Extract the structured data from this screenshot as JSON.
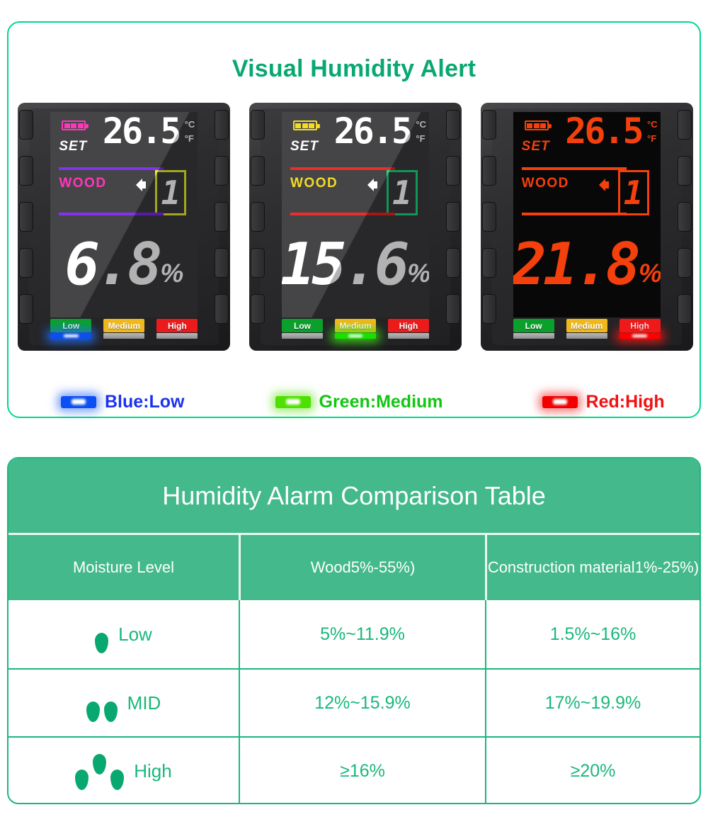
{
  "alert": {
    "title": "Visual Humidity Alert",
    "devices": [
      {
        "theme": "grey",
        "battery_color": "#ff2bb5",
        "set_label": "SET",
        "set_color": "#ffffff",
        "temperature": "26.5",
        "temp_color": "#ffffff",
        "unit_c": "°C",
        "unit_f": "°F",
        "rule_color": "#7b27ef",
        "mode_label": "WOOD",
        "mode_color": "#ff2bb5",
        "speaker_color": "#ffffff",
        "level_box_color": "#e8ef2a",
        "level_value": "1",
        "level_value_color": "#ffffff",
        "humidity": "6.8",
        "humidity_unit": "%",
        "humidity_color": "#ffffff",
        "leds": [
          {
            "label": "Low",
            "bg": "#0ba02c",
            "state": "on-blue"
          },
          {
            "label": "Medium",
            "bg": "#f0b81c",
            "state": "off"
          },
          {
            "label": "High",
            "bg": "#ec1b1b",
            "state": "off"
          }
        ]
      },
      {
        "theme": "grey",
        "battery_color": "#f2d91c",
        "set_label": "SET",
        "set_color": "#ffffff",
        "temperature": "26.5",
        "temp_color": "#ffffff",
        "unit_c": "°C",
        "unit_f": "°F",
        "rule_color": "#e8231f",
        "mode_label": "WOOD",
        "mode_color": "#f2d91c",
        "speaker_color": "#ffffff",
        "level_box_color": "#18d67e",
        "level_value": "1",
        "level_value_color": "#ffffff",
        "humidity": "15.6",
        "humidity_unit": "%",
        "humidity_color": "#ffffff",
        "leds": [
          {
            "label": "Low",
            "bg": "#0ba02c",
            "state": "off"
          },
          {
            "label": "Medium",
            "bg": "#f0b81c",
            "state": "on-green"
          },
          {
            "label": "High",
            "bg": "#ec1b1b",
            "state": "off"
          }
        ]
      },
      {
        "theme": "black",
        "battery_color": "#f4400c",
        "set_label": "SET",
        "set_color": "#f4400c",
        "temperature": "26.5",
        "temp_color": "#f4400c",
        "unit_c": "°C",
        "unit_f": "°F",
        "rule_color": "#f4400c",
        "mode_label": "WOOD",
        "mode_color": "#f4400c",
        "speaker_color": "#f4400c",
        "level_box_color": "#f4400c",
        "level_value": "1",
        "level_value_color": "#f4400c",
        "humidity": "21.8",
        "humidity_unit": "%",
        "humidity_color": "#f4400c",
        "leds": [
          {
            "label": "Low",
            "bg": "#0ba02c",
            "state": "off"
          },
          {
            "label": "Medium",
            "bg": "#f0b81c",
            "state": "off"
          },
          {
            "label": "High",
            "bg": "#ec1b1b",
            "state": "on-red"
          }
        ]
      }
    ],
    "legend": [
      {
        "label": "Blue:Low",
        "color": "#1b33ef",
        "swatch": "#0b4ff2"
      },
      {
        "label": "Green:Medium",
        "color": "#13c613",
        "swatch": "#4de000"
      },
      {
        "label": "Red:High",
        "color": "#f21111",
        "swatch": "#f00000"
      }
    ]
  },
  "table": {
    "title": "Humidity Alarm Comparison Table",
    "headers": [
      "Moisture Level",
      "Wood\n5%-55%)",
      "Construction material\n1%-25%)"
    ],
    "rows": [
      {
        "drops": 1,
        "level": "Low",
        "wood": "5%~11.9%",
        "construction": "1.5%~16%"
      },
      {
        "drops": 2,
        "level": "MID",
        "wood": "12%~15.9%",
        "construction": "17%~19.9%"
      },
      {
        "drops": 3,
        "level": "High",
        "wood": "≥16%",
        "construction": "≥20%"
      }
    ]
  },
  "colors": {
    "brand_green": "#0aa871",
    "table_green": "#43b98c",
    "border_green": "#00d88a",
    "text_green": "#19b87c"
  }
}
